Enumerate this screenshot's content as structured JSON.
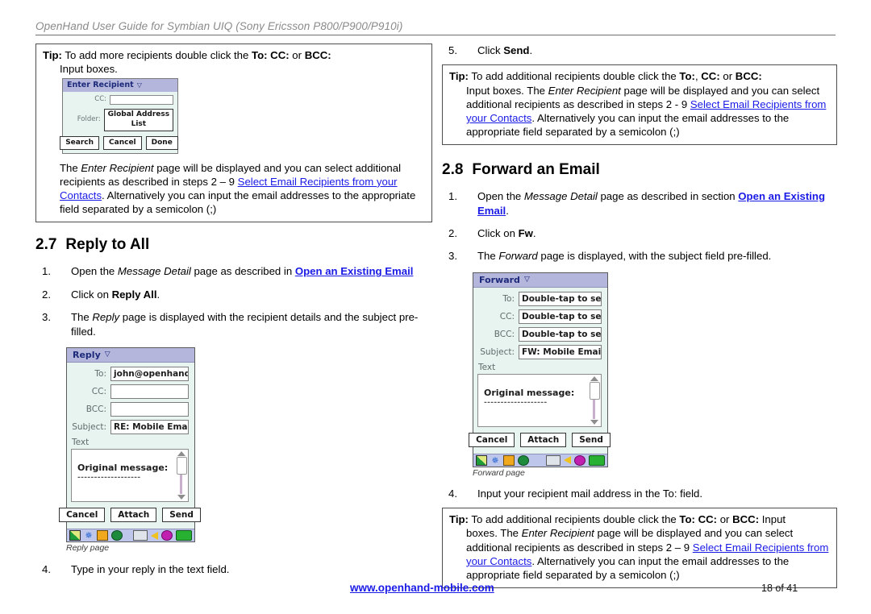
{
  "header": {
    "title": "OpenHand User Guide for Symbian UIQ (Sony Ericsson P800/P900/P910i)"
  },
  "left_column": {
    "tip1": {
      "label": "Tip:",
      "lead_text": " To add more recipients double click the ",
      "bold_fields": "To: CC:",
      "mid_text": " or ",
      "bold_fields2": "BCC:",
      "line2": "Input boxes.",
      "para_a": "The ",
      "para_a_ital": "Enter Recipient",
      "para_b": " page will be displayed and you can select additional recipients as described in steps 2 – 9  ",
      "link1": "Select Email Recipients from your",
      "link2": "Contacts",
      "para_c": ".  Alternatively you can input the email addresses to the appropriate field separated by a semicolon (;)"
    },
    "mini_screenshot": {
      "title": "Enter Recipient",
      "caret": "▽",
      "cc_label": "CC:",
      "folder_label": "Folder:",
      "folder_value": "Global Address List",
      "btn_search": "Search",
      "btn_cancel": "Cancel",
      "btn_done": "Done"
    },
    "section": {
      "number": "2.7",
      "title": "Reply to All"
    },
    "steps": [
      {
        "num": "1.",
        "text_a": "Open the ",
        "ital": "Message Detail",
        "text_b": " page as described in ",
        "link": "Open an Existing Email"
      },
      {
        "num": "2.",
        "text_a": "Click on ",
        "bold": "Reply All",
        "text_b": "."
      },
      {
        "num": "3.",
        "text_a": "The ",
        "ital": "Reply",
        "text_b": " page is displayed with the recipient details and the subject pre-filled."
      },
      {
        "num": "4.",
        "text_a": "Type in your reply in the text field."
      }
    ],
    "reply_screenshot": {
      "title": "Reply",
      "caret": "▽",
      "rows": [
        {
          "label": "To:",
          "value": "john@openhand.con"
        },
        {
          "label": "CC:",
          "value": ""
        },
        {
          "label": "BCC:",
          "value": ""
        },
        {
          "label": "Subject:",
          "value": "RE: Mobile Email"
        }
      ],
      "text_label": "Text",
      "body_line": "Original message:",
      "body_dashes": "-------------------",
      "btn_cancel": "Cancel",
      "btn_attach": "Attach",
      "btn_send": "Send",
      "caption": "Reply page",
      "taskbar_icons": [
        "signal-icon",
        "bluetooth-icon",
        "mail-icon",
        "browser-icon",
        "keyboard-icon",
        "speaker-icon",
        "clock-icon",
        "battery-icon"
      ]
    }
  },
  "right_column": {
    "step5": {
      "num": "5.",
      "text_a": "Click ",
      "bold": "Send",
      "text_b": "."
    },
    "tip2": {
      "label": "Tip:",
      "lead_a": " To add additional recipients double click the ",
      "b1": "To:",
      "sep1": ", ",
      "b2": "CC:",
      "sep2": " or ",
      "b3": "BCC:",
      "body_a": "Input boxes. The ",
      "body_ital": "Enter Recipient",
      "body_b": " page will be displayed and you can select additional recipients as described in steps 2 - 9 ",
      "link": "Select Email Recipients from your Contacts",
      "body_c": ". Alternatively you can input the email addresses to the appropriate field separated by a semicolon (;)"
    },
    "section": {
      "number": "2.8",
      "title": "Forward an Email"
    },
    "steps": [
      {
        "num": "1.",
        "text_a": "Open the ",
        "ital": "Message Detail",
        "text_b": " page as described in section ",
        "link": "Open an Existing Email",
        "text_c": "."
      },
      {
        "num": "2.",
        "text_a": "Click on ",
        "bold": "Fw",
        "text_b": "."
      },
      {
        "num": "3.",
        "text_a": "The ",
        "ital": "Forward",
        "text_b": " page is displayed, with the subject field pre-filled."
      },
      {
        "num": "4.",
        "text_a": "Input your recipient mail address in the To: field."
      }
    ],
    "forward_screenshot": {
      "title": "Forward",
      "caret": "▽",
      "rows": [
        {
          "label": "To:",
          "value": "Double-tap to search"
        },
        {
          "label": "CC:",
          "value": "Double-tap to search"
        },
        {
          "label": "BCC:",
          "value": "Double-tap to search"
        },
        {
          "label": "Subject:",
          "value": "FW: Mobile Email"
        }
      ],
      "text_label": "Text",
      "body_line": "Original message:",
      "body_dashes": "-------------------",
      "btn_cancel": "Cancel",
      "btn_attach": "Attach",
      "btn_send": "Send",
      "caption": "Forward page",
      "taskbar_icons": [
        "signal-icon",
        "bluetooth-icon",
        "mail-icon",
        "browser-icon",
        "keyboard-icon",
        "speaker-icon",
        "clock-icon",
        "battery-icon"
      ]
    },
    "tip3": {
      "label": "Tip:",
      "lead_a": " To add additional recipients double click the ",
      "b1": "To: CC:",
      "sep1": " or ",
      "b2": "BCC:",
      "lead_b": " Input",
      "body_a": "boxes. The ",
      "body_ital": "Enter Recipient",
      "body_b": " page will be displayed and you can select additional recipients as described in steps 2 – 9  ",
      "link": "Select Email Recipients from your Contacts",
      "body_c": ". Alternatively you can input the email addresses to the appropriate field separated by a semicolon (;)"
    }
  },
  "footer": {
    "url": "www.openhand-mobile.com",
    "page": "18 of 41"
  },
  "colors": {
    "link": "#1a1ae6",
    "header_gray": "#8a8a8a",
    "titlebar": "#b4b6dc",
    "phone_bg": "#e8f4ef",
    "taskbar": "#bfc6ec"
  }
}
